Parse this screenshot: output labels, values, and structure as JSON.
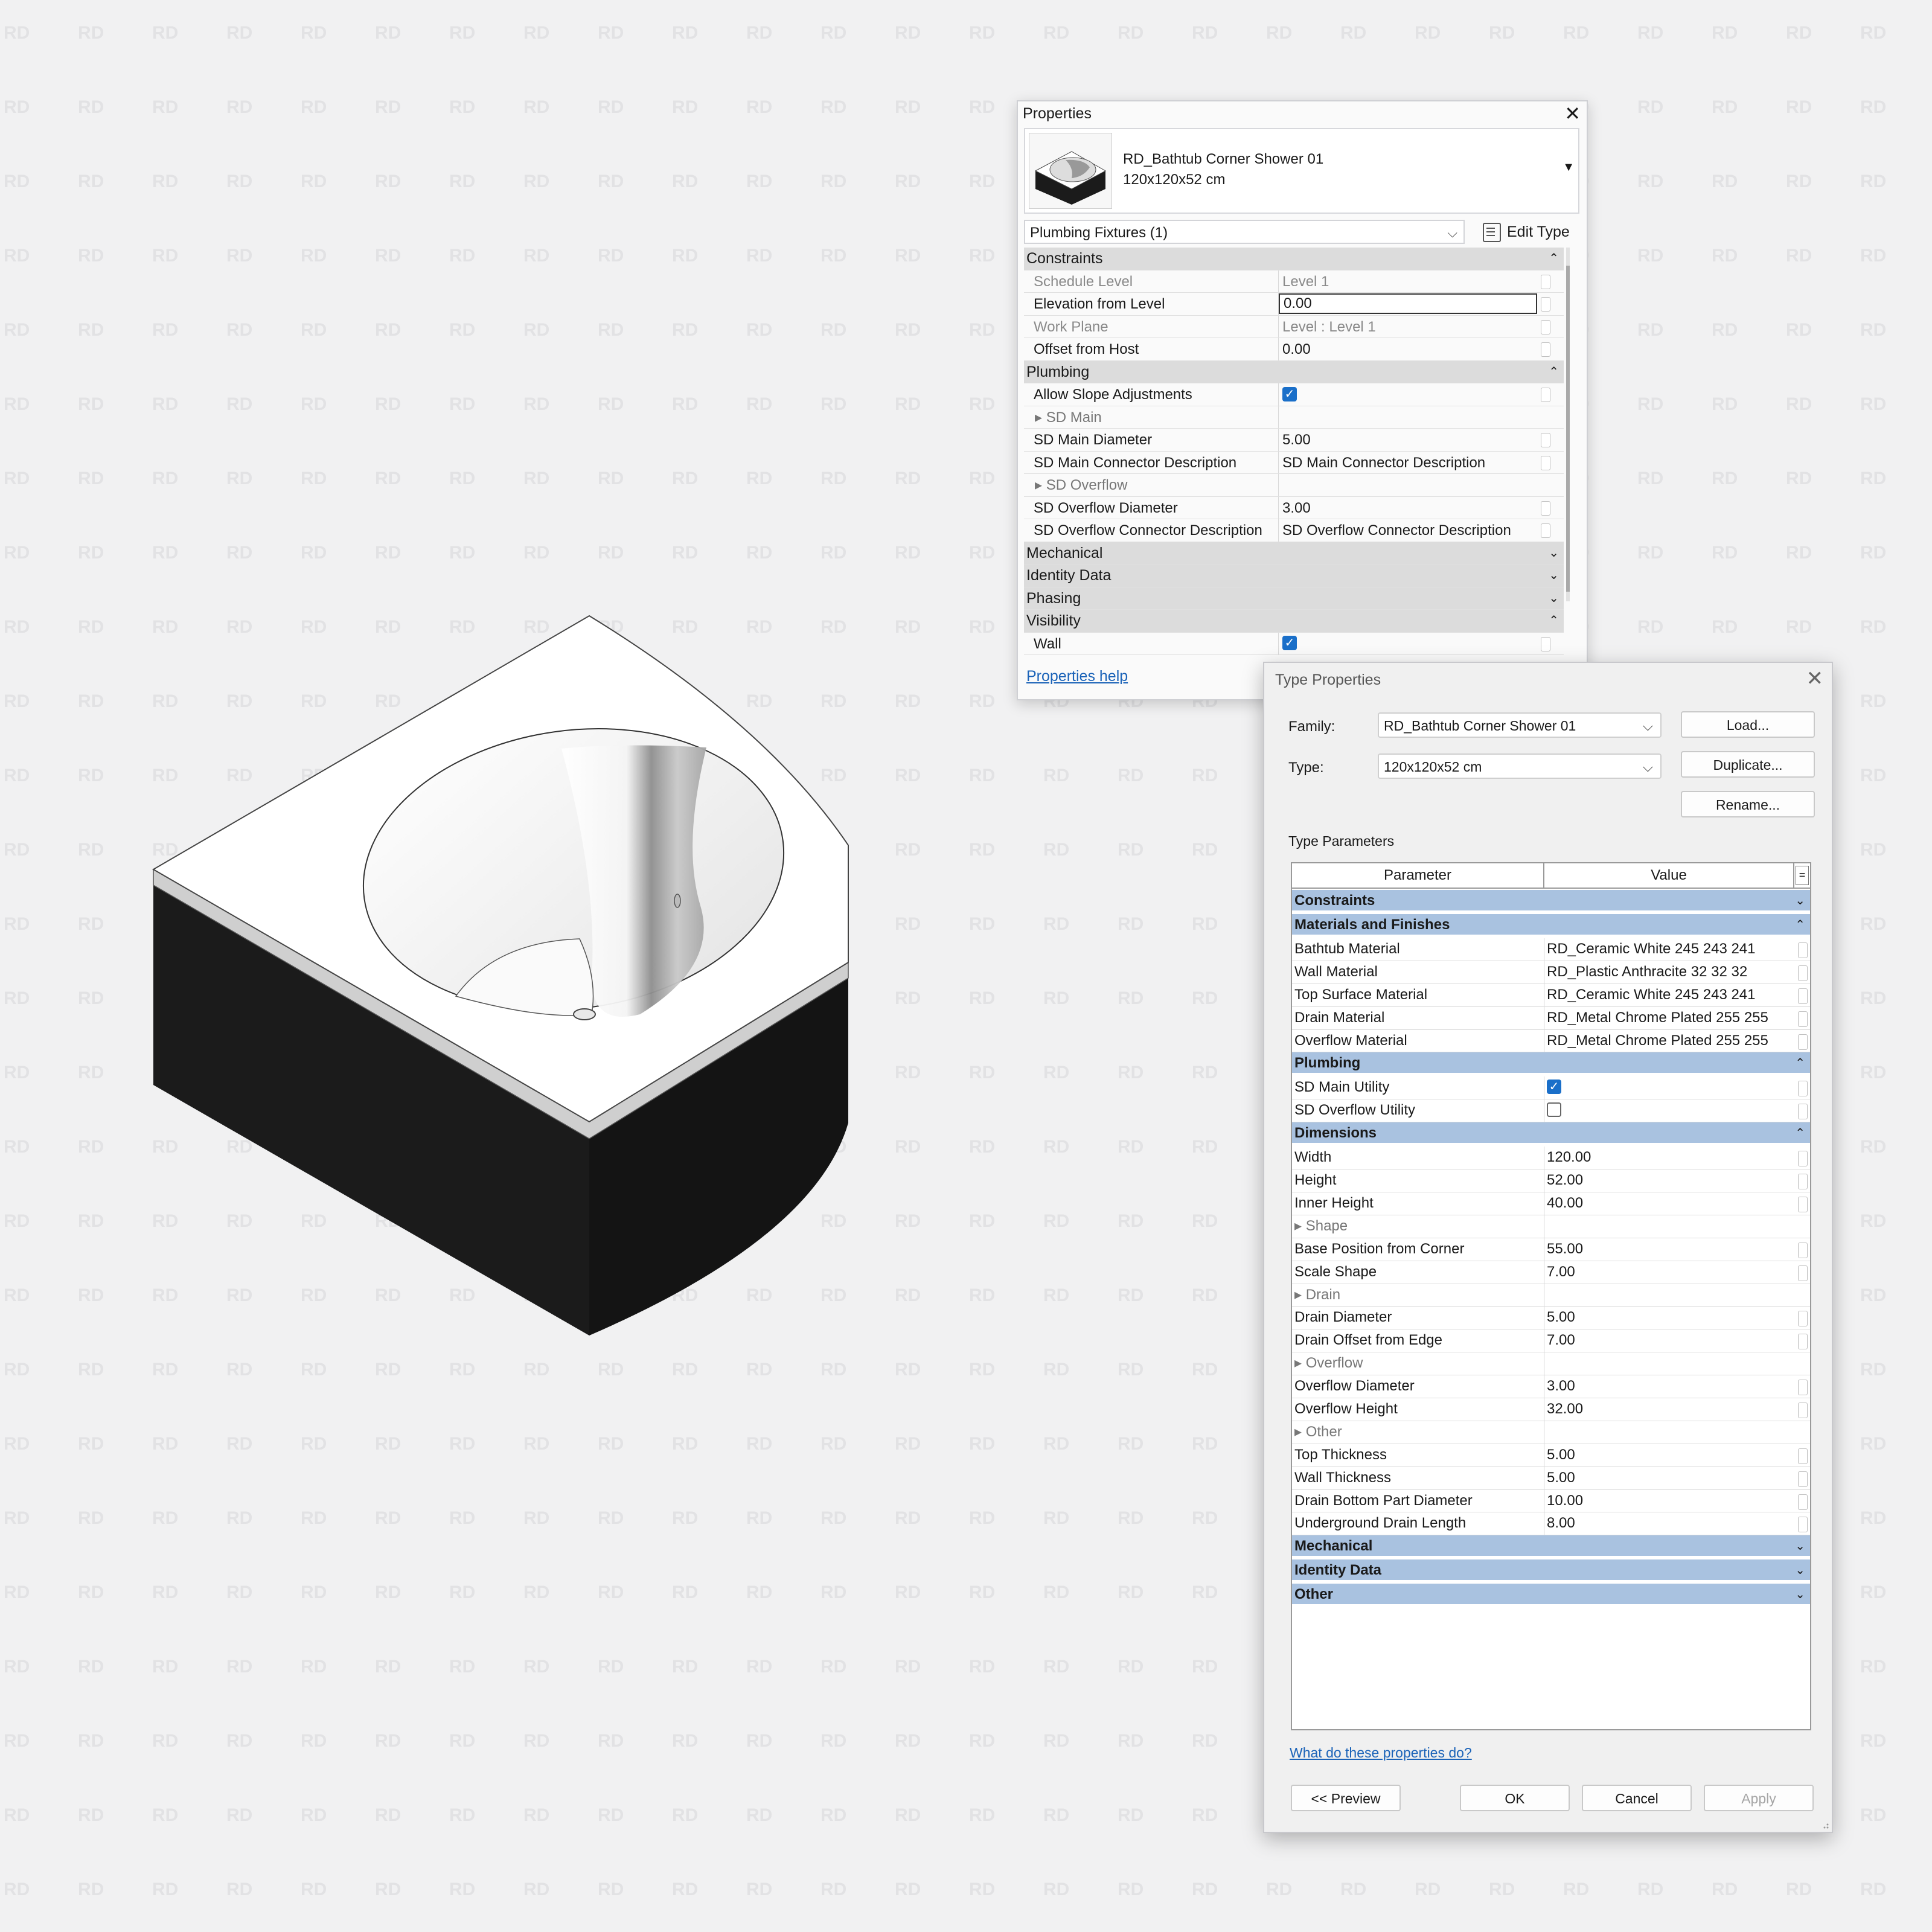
{
  "watermark_text": "RD",
  "properties": {
    "title": "Properties",
    "type_name": "RD_Bathtub Corner Shower 01",
    "type_size": "120x120x52 cm",
    "filter": "Plumbing Fixtures (1)",
    "edit_type": "Edit Type",
    "groups": [
      {
        "name": "Constraints",
        "state": "expanded",
        "rows": [
          {
            "label": "Schedule Level",
            "value": "Level 1",
            "readonly": true
          },
          {
            "label": "Elevation from Level",
            "value": "0.00",
            "editing": true
          },
          {
            "label": "Work Plane",
            "value": "Level : Level 1",
            "readonly": true
          },
          {
            "label": "Offset from Host",
            "value": "0.00"
          }
        ]
      },
      {
        "name": "Plumbing",
        "state": "expanded",
        "rows": [
          {
            "label": "Allow Slope Adjustments",
            "checkbox": true,
            "checked": true
          },
          {
            "label": "SD Main",
            "subheader": true
          },
          {
            "label": "SD Main Diameter",
            "value": "5.00"
          },
          {
            "label": "SD Main Connector Description",
            "value": "SD Main Connector Description"
          },
          {
            "label": "SD Overflow",
            "subheader": true
          },
          {
            "label": "SD Overflow Diameter",
            "value": "3.00"
          },
          {
            "label": "SD Overflow Connector Description",
            "value": "SD Overflow Connector Description"
          }
        ]
      },
      {
        "name": "Mechanical",
        "state": "collapsed",
        "rows": []
      },
      {
        "name": "Identity Data",
        "state": "collapsed",
        "rows": []
      },
      {
        "name": "Phasing",
        "state": "collapsed",
        "rows": []
      },
      {
        "name": "Visibility",
        "state": "expanded",
        "rows": [
          {
            "label": "Wall",
            "checkbox": true,
            "checked": true
          }
        ]
      }
    ],
    "help_link": "Properties help"
  },
  "type_properties": {
    "title": "Type Properties",
    "family_label": "Family:",
    "family_value": "RD_Bathtub Corner Shower 01",
    "type_label": "Type:",
    "type_value": "120x120x52 cm",
    "buttons": {
      "load": "Load...",
      "duplicate": "Duplicate...",
      "rename": "Rename..."
    },
    "section_label": "Type Parameters",
    "col_parameter": "Parameter",
    "col_value": "Value",
    "col_extra": "=",
    "groups": [
      {
        "name": "Constraints",
        "state": "collapsed",
        "rows": []
      },
      {
        "name": "Materials and Finishes",
        "state": "expanded",
        "rows": [
          {
            "label": "Bathtub Material",
            "value": "RD_Ceramic White 245 243 241"
          },
          {
            "label": "Wall Material",
            "value": "RD_Plastic Anthracite 32 32 32"
          },
          {
            "label": "Top Surface Material",
            "value": "RD_Ceramic White 245 243 241"
          },
          {
            "label": "Drain Material",
            "value": "RD_Metal Chrome Plated 255 255"
          },
          {
            "label": "Overflow Material",
            "value": "RD_Metal Chrome Plated 255 255"
          }
        ]
      },
      {
        "name": "Plumbing",
        "state": "expanded",
        "rows": [
          {
            "label": "SD Main Utility",
            "checkbox": true,
            "checked": true
          },
          {
            "label": "SD Overflow Utility",
            "checkbox": true,
            "checked": false
          }
        ]
      },
      {
        "name": "Dimensions",
        "state": "expanded",
        "rows": [
          {
            "label": "Width",
            "value": "120.00"
          },
          {
            "label": "Height",
            "value": "52.00"
          },
          {
            "label": "Inner Height",
            "value": "40.00"
          },
          {
            "label": "Shape",
            "subheader": true
          },
          {
            "label": "Base Position from Corner",
            "value": "55.00"
          },
          {
            "label": "Scale Shape",
            "value": "7.00"
          },
          {
            "label": "Drain",
            "subheader": true
          },
          {
            "label": "Drain Diameter",
            "value": "5.00"
          },
          {
            "label": "Drain Offset from Edge",
            "value": "7.00"
          },
          {
            "label": "Overflow",
            "subheader": true
          },
          {
            "label": "Overflow Diameter",
            "value": "3.00"
          },
          {
            "label": "Overflow Height",
            "value": "32.00"
          },
          {
            "label": "Other",
            "subheader": true
          },
          {
            "label": "Top Thickness",
            "value": "5.00"
          },
          {
            "label": "Wall Thickness",
            "value": "5.00"
          },
          {
            "label": "Drain Bottom Part Diameter",
            "value": "10.00"
          },
          {
            "label": "Underground Drain Length",
            "value": "8.00"
          }
        ]
      },
      {
        "name": "Mechanical",
        "state": "collapsed",
        "rows": []
      },
      {
        "name": "Identity Data",
        "state": "collapsed",
        "rows": []
      },
      {
        "name": "Other",
        "state": "collapsed",
        "rows": []
      }
    ],
    "help_link": "What do these properties do?",
    "footer": {
      "preview": "<< Preview",
      "ok": "OK",
      "cancel": "Cancel",
      "apply": "Apply"
    }
  },
  "colors": {
    "group_header_blue": "#a9c2e0",
    "link_blue": "#1b63b8",
    "checkbox_blue": "#1a6fc9",
    "tub_wall": "#1b1b1b",
    "tub_top": "#ffffff"
  }
}
